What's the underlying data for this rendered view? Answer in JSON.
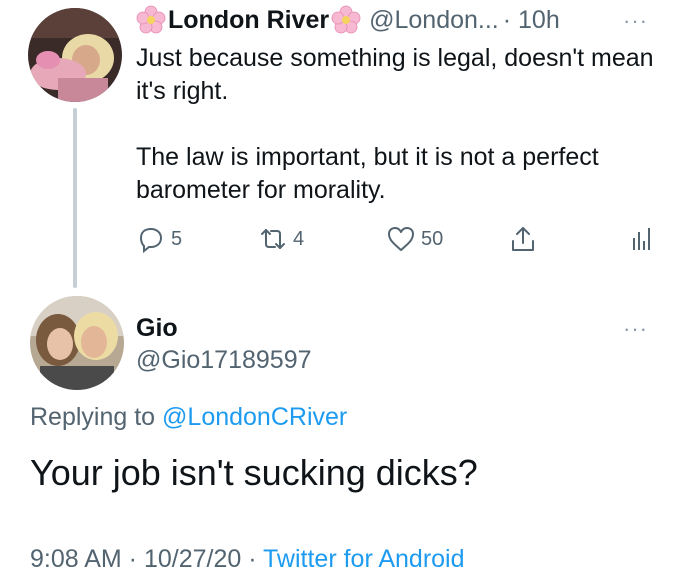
{
  "tweet": {
    "author_name": "London River",
    "author_handle": "@London...",
    "time": "· 10h",
    "more": "···",
    "text_line1": "Just because something is legal, doesn't mean it's right.",
    "text_line2": "The law is important, but it is not a perfect barometer for morality.",
    "actions": {
      "reply_count": "5",
      "retweet_count": "4",
      "like_count": "50"
    }
  },
  "reply": {
    "author_name": "Gio",
    "author_handle": "@Gio17189597",
    "more": "···",
    "replying_prefix": "Replying to",
    "replying_to": "@LondonCRiver",
    "text": "Your job isn't sucking dicks?",
    "timestamp": "9:08 AM · 10/27/20 ·",
    "source": "Twitter for Android"
  },
  "colors": {
    "link": "#1d9bf0",
    "secondary_text": "#536471",
    "thread_line": "#c4cfd6"
  },
  "icons": [
    "flower-icon",
    "reply-icon",
    "retweet-icon",
    "like-icon",
    "share-icon",
    "analytics-icon",
    "more-icon"
  ]
}
